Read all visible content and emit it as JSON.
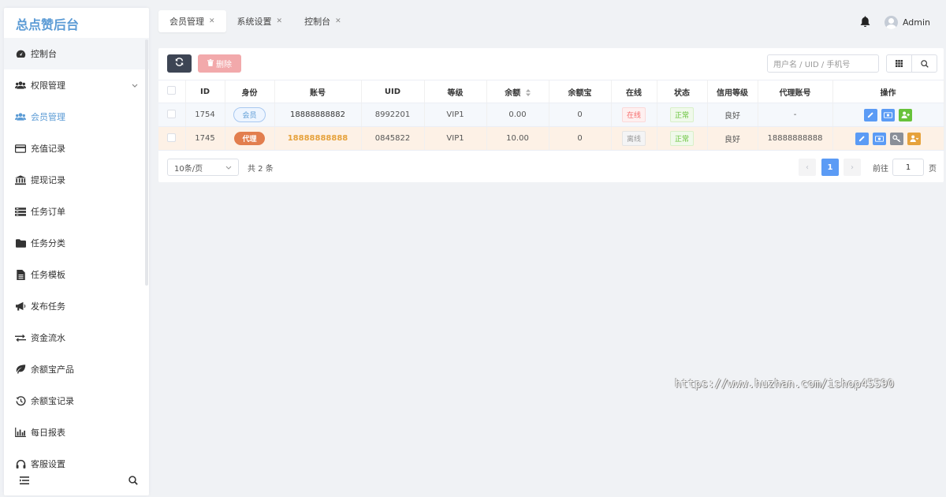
{
  "sidebar": {
    "brand": "总点赞后台",
    "items": [
      {
        "label": "控制台",
        "icon": "dashboard-icon"
      },
      {
        "label": "权限管理",
        "icon": "users-icon"
      },
      {
        "label": "会员管理",
        "icon": "users-icon"
      },
      {
        "label": "充值记录",
        "icon": "credit-card-icon"
      },
      {
        "label": "提现记录",
        "icon": "bank-icon"
      },
      {
        "label": "任务订单",
        "icon": "list-icon"
      },
      {
        "label": "任务分类",
        "icon": "folder-icon"
      },
      {
        "label": "任务模板",
        "icon": "file-icon"
      },
      {
        "label": "发布任务",
        "icon": "megaphone-icon"
      },
      {
        "label": "资金流水",
        "icon": "exchange-icon"
      },
      {
        "label": "余额宝产品",
        "icon": "leaf-icon"
      },
      {
        "label": "余额宝记录",
        "icon": "history-icon"
      },
      {
        "label": "每日报表",
        "icon": "bar-chart-icon"
      },
      {
        "label": "客服设置",
        "icon": "headset-icon"
      }
    ]
  },
  "tabs": [
    {
      "label": "会员管理"
    },
    {
      "label": "系统设置"
    },
    {
      "label": "控制台"
    }
  ],
  "header": {
    "user": "Admin"
  },
  "toolbar": {
    "delete_label": "删除",
    "search_placeholder": "用户名 / UID / 手机号"
  },
  "table": {
    "columns": [
      "ID",
      "身份",
      "账号",
      "UID",
      "等级",
      "余额",
      "余额宝",
      "在线",
      "状态",
      "信用等级",
      "代理账号",
      "操作"
    ],
    "rows": [
      {
        "id": "1754",
        "role": "会员",
        "account": "18888888882",
        "uid": "8992201",
        "level": "VIP1",
        "balance": "0.00",
        "yuebao": "0",
        "online": "在线",
        "status": "正常",
        "credit": "良好",
        "agent": "-"
      },
      {
        "id": "1745",
        "role": "代理",
        "account": "18888888888",
        "uid": "0845822",
        "level": "VIP1",
        "balance": "10.00",
        "yuebao": "0",
        "online": "离线",
        "status": "正常",
        "credit": "良好",
        "agent": "18888888888"
      }
    ]
  },
  "pager": {
    "page_size": "10条/页",
    "total": "共 2 条",
    "current_page": "1",
    "goto_label": "前往",
    "goto_value": "1",
    "page_unit": "页"
  },
  "watermark": "https://www.huzhan.com/ishop45590"
}
